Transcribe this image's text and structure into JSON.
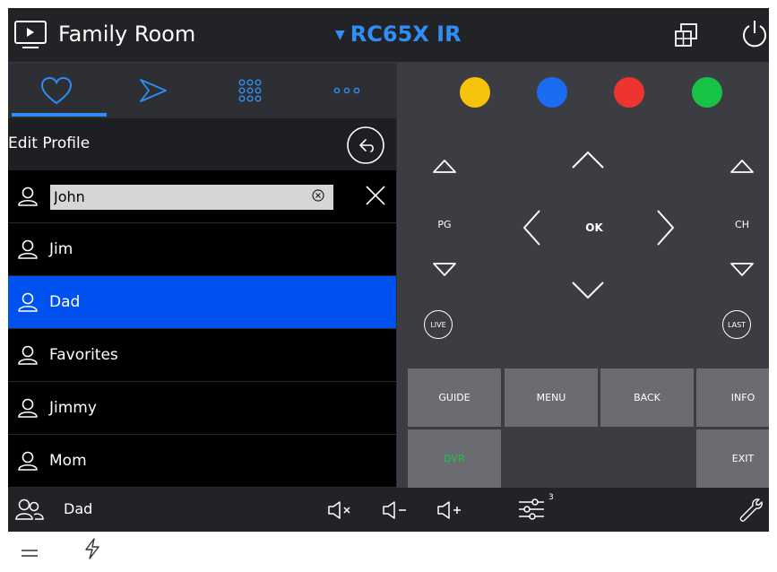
{
  "header": {
    "room_name": "Family Room",
    "device_name": "RC65X IR",
    "accent_color": "#2e8ef5"
  },
  "tabs": [
    {
      "icon": "heart-icon",
      "selected": true
    },
    {
      "icon": "play-icon",
      "selected": false
    },
    {
      "icon": "keypad-icon",
      "selected": false
    },
    {
      "icon": "more-icon",
      "selected": false
    }
  ],
  "edit_profile": {
    "title": "Edit Profile",
    "input_value": "John"
  },
  "profiles": [
    {
      "label": "Jim",
      "selected": false
    },
    {
      "label": "Dad",
      "selected": true
    },
    {
      "label": "Favorites",
      "selected": false
    },
    {
      "label": "Jimmy",
      "selected": false
    },
    {
      "label": "Mom",
      "selected": false
    }
  ],
  "remote": {
    "color_buttons": [
      "#f6c20c",
      "#1a6cf0",
      "#ef3430",
      "#17c448"
    ],
    "pg_label": "PG",
    "ok_label": "OK",
    "ch_label": "CH",
    "live_label": "LIVE",
    "last_label": "LAST",
    "buttons": {
      "guide": "GUIDE",
      "menu": "MENU",
      "back": "BACK",
      "info": "INFO",
      "dvr": "DVR",
      "exit": "EXIT"
    },
    "dvr_color": "#19c640"
  },
  "bottom_bar": {
    "profile": "Dad",
    "subwoofer_count": "3"
  }
}
